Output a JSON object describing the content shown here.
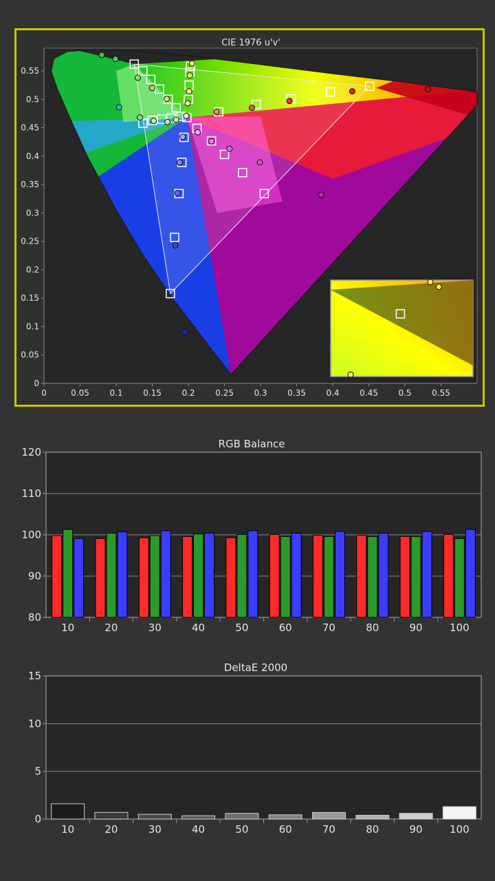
{
  "colors": {
    "frame": "#c8c800",
    "panel": "#303030",
    "plot": "#262626",
    "text": "#e6e6e6",
    "grid": "#6a6a6a"
  },
  "cie": {
    "title": "CIE 1976 u'v'",
    "x_ticks": [
      "0",
      "0.05",
      "0.1",
      "0.15",
      "0.2",
      "0.25",
      "0.3",
      "0.35",
      "0.4",
      "0.45",
      "0.5",
      "0.55"
    ],
    "y_ticks": [
      "0",
      "0.05",
      "0.1",
      "0.15",
      "0.2",
      "0.25",
      "0.3",
      "0.35",
      "0.4",
      "0.45",
      "0.5",
      "0.55"
    ],
    "xlim": [
      0,
      0.6
    ],
    "ylim": [
      0,
      0.59
    ],
    "gamut": {
      "red": [
        0.451,
        0.523
      ],
      "green": [
        0.125,
        0.562
      ],
      "blue": [
        0.175,
        0.158
      ],
      "white": [
        0.198,
        0.468
      ]
    },
    "targets": [
      [
        0.125,
        0.562
      ],
      [
        0.137,
        0.55
      ],
      [
        0.148,
        0.535
      ],
      [
        0.16,
        0.518
      ],
      [
        0.172,
        0.5
      ],
      [
        0.183,
        0.485
      ],
      [
        0.137,
        0.458
      ],
      [
        0.15,
        0.463
      ],
      [
        0.163,
        0.465
      ],
      [
        0.176,
        0.467
      ],
      [
        0.19,
        0.47
      ],
      [
        0.203,
        0.558
      ],
      [
        0.202,
        0.548
      ],
      [
        0.201,
        0.525
      ],
      [
        0.2,
        0.5
      ],
      [
        0.198,
        0.468
      ],
      [
        0.242,
        0.478
      ],
      [
        0.294,
        0.491
      ],
      [
        0.342,
        0.501
      ],
      [
        0.397,
        0.513
      ],
      [
        0.451,
        0.523
      ],
      [
        0.212,
        0.449
      ],
      [
        0.232,
        0.427
      ],
      [
        0.25,
        0.403
      ],
      [
        0.275,
        0.371
      ],
      [
        0.305,
        0.334
      ],
      [
        0.194,
        0.433
      ],
      [
        0.191,
        0.389
      ],
      [
        0.187,
        0.334
      ],
      [
        0.181,
        0.257
      ],
      [
        0.175,
        0.158
      ]
    ],
    "measured": [
      {
        "u": 0.08,
        "v": 0.578,
        "c": "#44bb44"
      },
      {
        "u": 0.099,
        "v": 0.571,
        "c": "#55c855"
      },
      {
        "u": 0.104,
        "v": 0.486,
        "c": "#33bbbb"
      },
      {
        "u": 0.13,
        "v": 0.538,
        "c": "#99dd55"
      },
      {
        "u": 0.133,
        "v": 0.468,
        "c": "#88dd88"
      },
      {
        "u": 0.15,
        "v": 0.52,
        "c": "#bbdd55"
      },
      {
        "u": 0.152,
        "v": 0.462,
        "c": "#bbeeaa"
      },
      {
        "u": 0.17,
        "v": 0.501,
        "c": "#dddd77"
      },
      {
        "u": 0.171,
        "v": 0.46,
        "c": "#ccddbb"
      },
      {
        "u": 0.183,
        "v": 0.464,
        "c": "#ddddcc"
      },
      {
        "u": 0.197,
        "v": 0.471,
        "c": "#e6e6e6"
      },
      {
        "u": 0.205,
        "v": 0.563,
        "c": "#ffee55"
      },
      {
        "u": 0.202,
        "v": 0.542,
        "c": "#eeee66"
      },
      {
        "u": 0.201,
        "v": 0.514,
        "c": "#eeee88"
      },
      {
        "u": 0.199,
        "v": 0.493,
        "c": "#eeeeaa"
      },
      {
        "u": 0.239,
        "v": 0.478,
        "c": "#ee8888"
      },
      {
        "u": 0.288,
        "v": 0.485,
        "c": "#ee5555"
      },
      {
        "u": 0.34,
        "v": 0.497,
        "c": "#ee3333"
      },
      {
        "u": 0.427,
        "v": 0.514,
        "c": "#dd2222"
      },
      {
        "u": 0.532,
        "v": 0.518,
        "c": "#cc1111"
      },
      {
        "u": 0.213,
        "v": 0.442,
        "c": "#eeaaee"
      },
      {
        "u": 0.232,
        "v": 0.426,
        "c": "#dd88dd"
      },
      {
        "u": 0.257,
        "v": 0.413,
        "c": "#dd66dd"
      },
      {
        "u": 0.299,
        "v": 0.389,
        "c": "#cc55cc"
      },
      {
        "u": 0.384,
        "v": 0.332,
        "c": "#bb22bb"
      },
      {
        "u": 0.192,
        "v": 0.434,
        "c": "#aaaaee"
      },
      {
        "u": 0.188,
        "v": 0.389,
        "c": "#8888ee"
      },
      {
        "u": 0.185,
        "v": 0.335,
        "c": "#6666ee"
      },
      {
        "u": 0.182,
        "v": 0.243,
        "c": "#4444dd"
      },
      {
        "u": 0.195,
        "v": 0.09,
        "c": "#2222cc"
      }
    ],
    "inset": {
      "target": {
        "x": 0.49,
        "y": 0.35
      },
      "points": [
        {
          "x": 0.7,
          "y": 0.02,
          "c": "#ffee55"
        },
        {
          "x": 0.76,
          "y": 0.07,
          "c": "#ffee55"
        },
        {
          "x": 0.14,
          "y": 0.98,
          "c": "#eeee66"
        }
      ]
    }
  },
  "rgb_balance": {
    "title": "RGB Balance",
    "type": "bar",
    "categories": [
      "10",
      "20",
      "30",
      "40",
      "50",
      "60",
      "70",
      "80",
      "90",
      "100"
    ],
    "y_ticks": [
      "80",
      "90",
      "100",
      "110",
      "120"
    ],
    "ylim": [
      80,
      120
    ],
    "series": [
      {
        "color": "#ff2a2a",
        "values": [
          99.8,
          99.1,
          99.3,
          99.6,
          99.3,
          100.1,
          99.9,
          99.9,
          99.6,
          100.1
        ]
      },
      {
        "color": "#2a9a2a",
        "values": [
          101.3,
          100.4,
          99.8,
          100.2,
          100.1,
          99.6,
          99.6,
          99.6,
          99.6,
          99.1
        ]
      },
      {
        "color": "#3c3cff",
        "values": [
          99.1,
          100.7,
          101.0,
          100.4,
          101.0,
          100.4,
          100.8,
          100.4,
          100.8,
          101.3
        ]
      }
    ]
  },
  "delta_e": {
    "title": "DeltaE 2000",
    "type": "bar",
    "categories": [
      "10",
      "20",
      "30",
      "40",
      "50",
      "60",
      "70",
      "80",
      "90",
      "100"
    ],
    "y_ticks": [
      "0",
      "5",
      "10",
      "15"
    ],
    "ylim": [
      0,
      15
    ],
    "values": [
      1.6,
      0.7,
      0.5,
      0.35,
      0.6,
      0.45,
      0.7,
      0.4,
      0.6,
      1.3
    ],
    "bar_colors": [
      "#1c1c1c",
      "#3a3a3a",
      "#4a4a4a",
      "#5a5a5a",
      "#6e6e6e",
      "#808080",
      "#9a9a9a",
      "#b0b0b0",
      "#cfcfcf",
      "#f4f4f4"
    ]
  }
}
